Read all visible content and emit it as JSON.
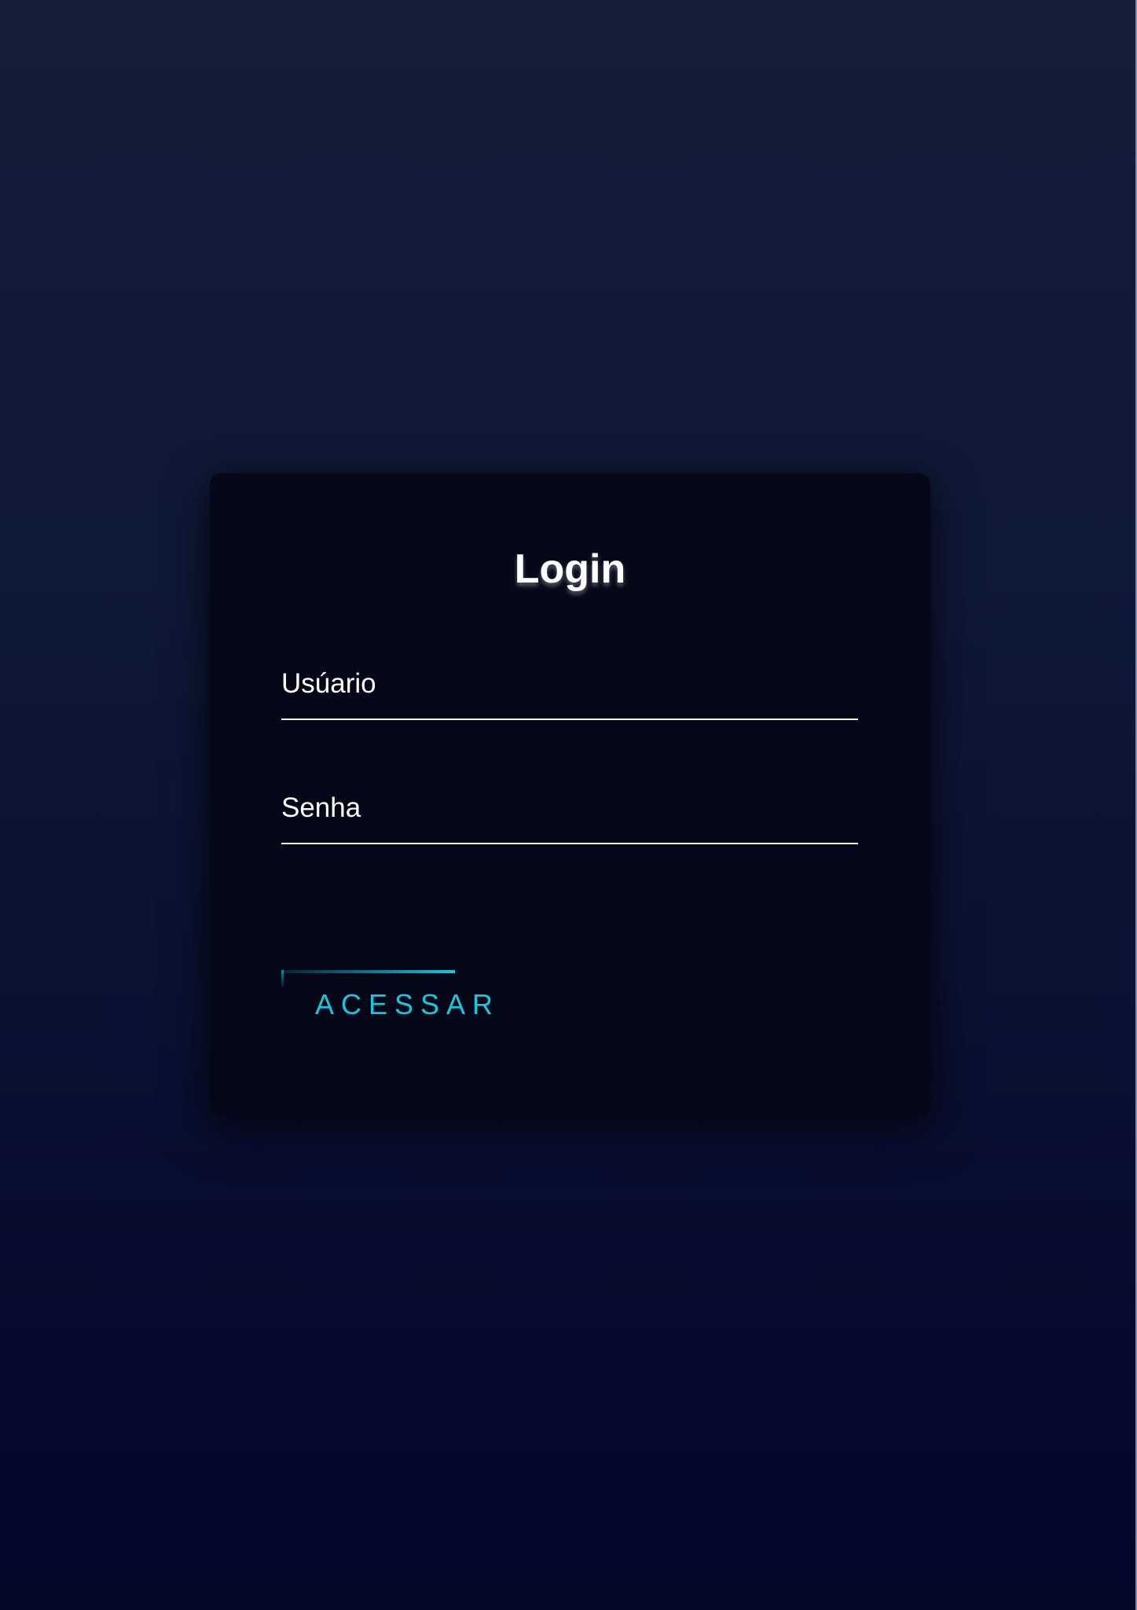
{
  "login": {
    "title": "Login",
    "username_label": "Usúario",
    "password_label": "Senha",
    "submit_label": "ACESSAR"
  },
  "colors": {
    "accent": "#12c9e0",
    "card_background": "#040716",
    "page_background_top": "#141e38",
    "page_background_bottom": "#04062a",
    "text": "#ffffff"
  },
  "icons": {
    "button_decoration": "corner-accent-lines"
  }
}
